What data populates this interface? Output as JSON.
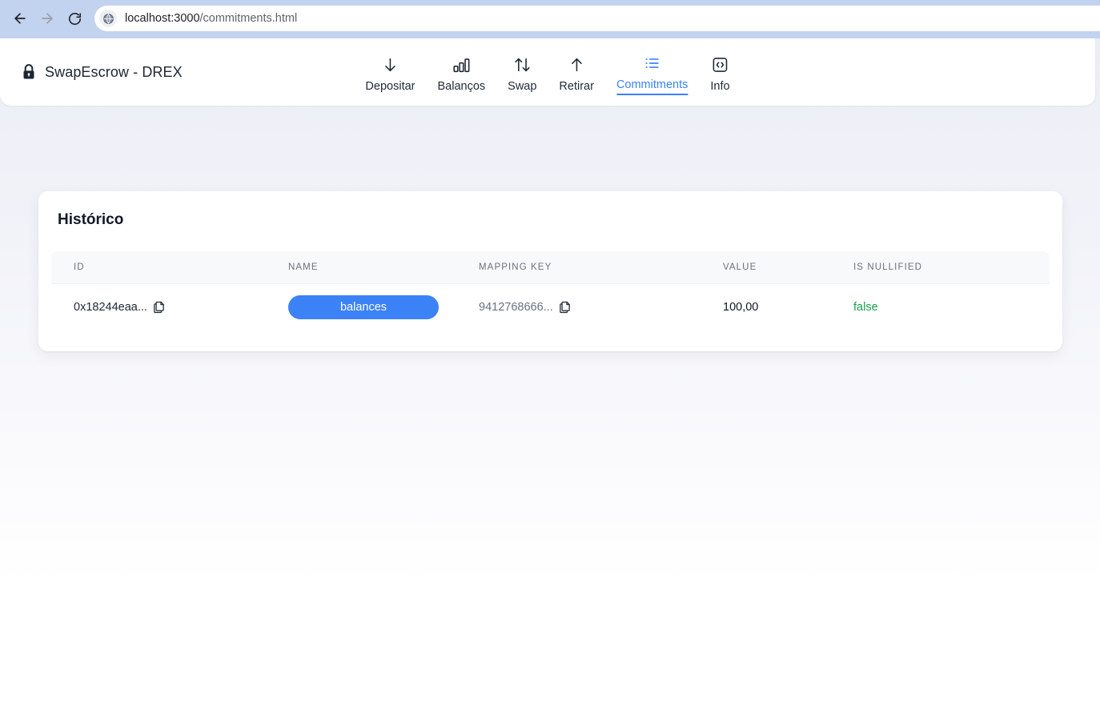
{
  "browser": {
    "back_icon": "back-arrow-icon",
    "forward_icon": "forward-arrow-icon",
    "reload_icon": "reload-icon",
    "favicon": "globe-icon",
    "url_host": "localhost:3000",
    "url_path": "/commitments.html",
    "url_full": "localhost:3000/commitments.html"
  },
  "header": {
    "lock_icon": "lock-icon",
    "brand_title": "SwapEscrow - DREX",
    "nav": [
      {
        "id": "depositar",
        "label": "Depositar",
        "icon": "arrow-down-icon",
        "active": false
      },
      {
        "id": "balancos",
        "label": "Balanços",
        "icon": "bar-chart-icon",
        "active": false
      },
      {
        "id": "swap",
        "label": "Swap",
        "icon": "arrows-swap-icon",
        "active": false
      },
      {
        "id": "retirar",
        "label": "Retirar",
        "icon": "arrow-up-icon",
        "active": false
      },
      {
        "id": "commitments",
        "label": "Commitments",
        "icon": "list-icon",
        "active": true
      },
      {
        "id": "info",
        "label": "Info",
        "icon": "code-brackets-icon",
        "active": false
      }
    ],
    "active_color": "#3b82f6"
  },
  "card": {
    "title": "Histórico",
    "table": {
      "columns": [
        "ID",
        "NAME",
        "MAPPING KEY",
        "VALUE",
        "IS NULLIFIED"
      ],
      "rows": [
        {
          "id": "0x18244eaa...",
          "id_copy_icon": "copy-icon",
          "name": "balances",
          "mapping_key": "9412768666...",
          "mapping_copy_icon": "copy-icon",
          "value": "100,00",
          "is_nullified": "false"
        }
      ]
    }
  },
  "colors": {
    "accent": "#3b82f6",
    "badge_bg": "#3b82f6",
    "success": "#16a34a",
    "chrome_bg": "#c2d3ef",
    "page_bg_top": "#eceef6",
    "page_bg_bottom": "#ffffff"
  }
}
